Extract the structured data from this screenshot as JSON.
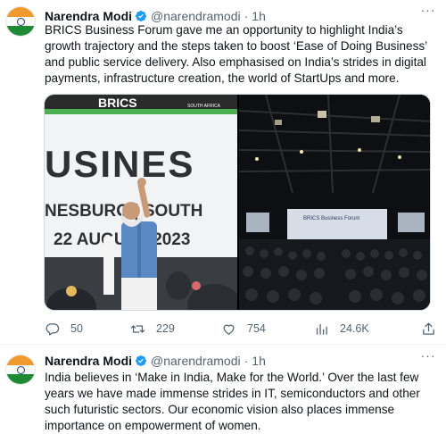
{
  "tweets": [
    {
      "author_name": "Narendra Modi",
      "handle": "@narendramodi",
      "separator": "·",
      "time": "1h",
      "more": "···",
      "text": "BRICS Business Forum gave me an opportunity to highlight India’s growth trajectory and the steps taken to boost ‘Ease of Doing Business’ and public service delivery. Also emphasised on India’s strides in digital payments, infrastructure creation, the world of StartUps and more.",
      "media": {
        "left_banner": {
          "top": "BRICS",
          "top_sub": "SOUTH AFRICA",
          "big": "USINES",
          "line2": "NESBURG | SOUTH",
          "line3": "22 AUGUST 2023"
        },
        "right_screen": "BRICS Business Forum"
      },
      "actions": {
        "replies": "50",
        "retweets": "229",
        "likes": "754",
        "views": "24.6K"
      }
    },
    {
      "author_name": "Narendra Modi",
      "handle": "@narendramodi",
      "separator": "·",
      "time": "1h",
      "more": "···",
      "text": "India believes in ‘Make in India, Make for the World.’ Over the last few years we have made immense strides in IT, semiconductors and other such futuristic sectors. Our economic vision also places immense importance on empowerment of women."
    }
  ],
  "colors": {
    "verified": "#1d9bf0",
    "muted": "#536471",
    "text": "#0f1419"
  }
}
